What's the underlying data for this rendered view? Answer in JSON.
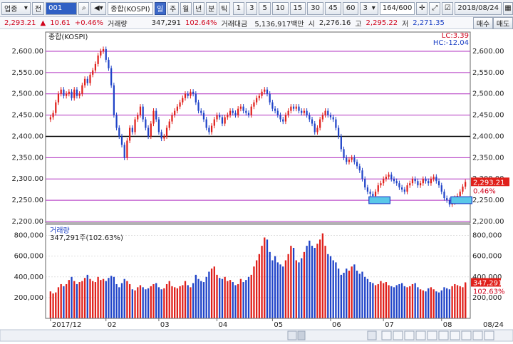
{
  "toolbar": {
    "category": "업종",
    "jeon": "전",
    "code": "001",
    "index_name": "종합(KOSPI)",
    "periods": [
      "일",
      "주",
      "월",
      "년",
      "분",
      "틱"
    ],
    "selected_period": "일",
    "minutes": [
      "1",
      "3",
      "5",
      "10",
      "15",
      "30",
      "45",
      "60"
    ],
    "interval_value": "3",
    "count": "164/600",
    "date": "2018/08/24"
  },
  "quote": {
    "price": "2,293.21",
    "arrow": "▲",
    "change": "10.61",
    "change_pct": "+0.46%",
    "volume_label": "거래량",
    "volume": "347,291",
    "volume_pct": "102.64%",
    "amount_label": "거래대금",
    "amount": "5,136,917백만",
    "open_label": "시",
    "open": "2,276.16",
    "high_label": "고",
    "high": "2,295.22",
    "low_label": "저",
    "low": "2,271.35",
    "buy_label": "매수",
    "sell_label": "매도"
  },
  "chart_data": [
    {
      "type": "candlestick",
      "title": "종합(KOSPI)",
      "ylim": [
        2200,
        2615
      ],
      "y_ticks": [
        "2,600.00",
        "2,550.00",
        "2,500.00",
        "2,450.00",
        "2,400.00",
        "2,350.00",
        "2,300.00",
        "2,250.00",
        "2,200.00"
      ],
      "x_ticks": [
        "2017/12",
        "02",
        "03",
        "04",
        "05",
        "06",
        "07",
        "08"
      ],
      "last_value": "2,293.21",
      "last_change": "0.46%",
      "lc": "LC:3.39",
      "hc": "HC:-12.04",
      "reference_level": 2400,
      "closes": [
        2445,
        2455,
        2480,
        2500,
        2510,
        2495,
        2500,
        2505,
        2490,
        2510,
        2495,
        2500,
        2520,
        2535,
        2525,
        2545,
        2555,
        2570,
        2590,
        2600,
        2605,
        2580,
        2560,
        2520,
        2450,
        2420,
        2400,
        2380,
        2350,
        2390,
        2420,
        2410,
        2440,
        2450,
        2470,
        2440,
        2420,
        2400,
        2430,
        2460,
        2440,
        2410,
        2395,
        2400,
        2420,
        2435,
        2450,
        2460,
        2470,
        2480,
        2490,
        2500,
        2495,
        2505,
        2500,
        2480,
        2460,
        2455,
        2440,
        2420,
        2410,
        2425,
        2440,
        2450,
        2445,
        2430,
        2445,
        2450,
        2460,
        2455,
        2450,
        2465,
        2470,
        2460,
        2455,
        2450,
        2470,
        2480,
        2490,
        2495,
        2505,
        2510,
        2500,
        2480,
        2465,
        2460,
        2450,
        2440,
        2435,
        2450,
        2460,
        2470,
        2465,
        2470,
        2460,
        2455,
        2460,
        2450,
        2440,
        2430,
        2410,
        2420,
        2440,
        2450,
        2460,
        2450,
        2445,
        2440,
        2420,
        2400,
        2370,
        2350,
        2340,
        2345,
        2350,
        2340,
        2330,
        2320,
        2300,
        2280,
        2270,
        2265,
        2260,
        2270,
        2285,
        2290,
        2300,
        2305,
        2310,
        2300,
        2295,
        2290,
        2280,
        2275,
        2270,
        2285,
        2290,
        2300,
        2295,
        2285,
        2290,
        2300,
        2295,
        2290,
        2300,
        2305,
        2295,
        2285,
        2270,
        2255,
        2250,
        2240,
        2245,
        2255,
        2260,
        2270,
        2282,
        2293
      ],
      "highlight_boxes": [
        {
          "from_index": 121,
          "to_index": 128,
          "low": 2242,
          "high": 2258
        },
        {
          "from_index": 152,
          "to_index": 159,
          "low": 2242,
          "high": 2258
        }
      ]
    },
    {
      "type": "bar",
      "title": "거래량",
      "subtitle": "347,291주(102.63%)",
      "ylim": [
        0,
        900000
      ],
      "y_ticks": [
        "800,000",
        "600,000",
        "400,000",
        "200,000"
      ],
      "right_ticks": [
        "800,000",
        "600,000",
        "400,000",
        "200,000"
      ],
      "last_value": "347,291",
      "last_pct": "102.63%",
      "values": [
        260000,
        240000,
        250000,
        300000,
        330000,
        310000,
        330000,
        370000,
        400000,
        360000,
        330000,
        350000,
        360000,
        390000,
        420000,
        380000,
        360000,
        350000,
        400000,
        370000,
        380000,
        360000,
        390000,
        410000,
        400000,
        330000,
        300000,
        340000,
        380000,
        360000,
        330000,
        280000,
        270000,
        300000,
        320000,
        300000,
        280000,
        290000,
        310000,
        330000,
        340000,
        300000,
        280000,
        290000,
        330000,
        360000,
        310000,
        300000,
        290000,
        310000,
        320000,
        360000,
        320000,
        300000,
        340000,
        420000,
        380000,
        360000,
        350000,
        400000,
        450000,
        480000,
        500000,
        420000,
        390000,
        380000,
        400000,
        360000,
        370000,
        350000,
        320000,
        330000,
        380000,
        350000,
        370000,
        400000,
        420000,
        500000,
        560000,
        620000,
        700000,
        780000,
        760000,
        640000,
        560000,
        600000,
        540000,
        520000,
        500000,
        560000,
        620000,
        700000,
        680000,
        560000,
        540000,
        580000,
        640000,
        700000,
        750000,
        700000,
        680000,
        720000,
        760000,
        820000,
        700000,
        620000,
        600000,
        560000,
        540000,
        480000,
        420000,
        440000,
        480000,
        460000,
        500000,
        520000,
        460000,
        430000,
        450000,
        400000,
        380000,
        350000,
        340000,
        320000,
        330000,
        360000,
        340000,
        350000,
        320000,
        310000,
        300000,
        320000,
        330000,
        340000,
        310000,
        300000,
        310000,
        330000,
        340000,
        300000,
        280000,
        270000,
        260000,
        290000,
        300000,
        280000,
        260000,
        250000,
        270000,
        300000,
        290000,
        280000,
        310000,
        330000,
        320000,
        310000,
        300000,
        320000,
        340000,
        347291
      ]
    }
  ],
  "footer": {
    "date_right": "08/24"
  }
}
